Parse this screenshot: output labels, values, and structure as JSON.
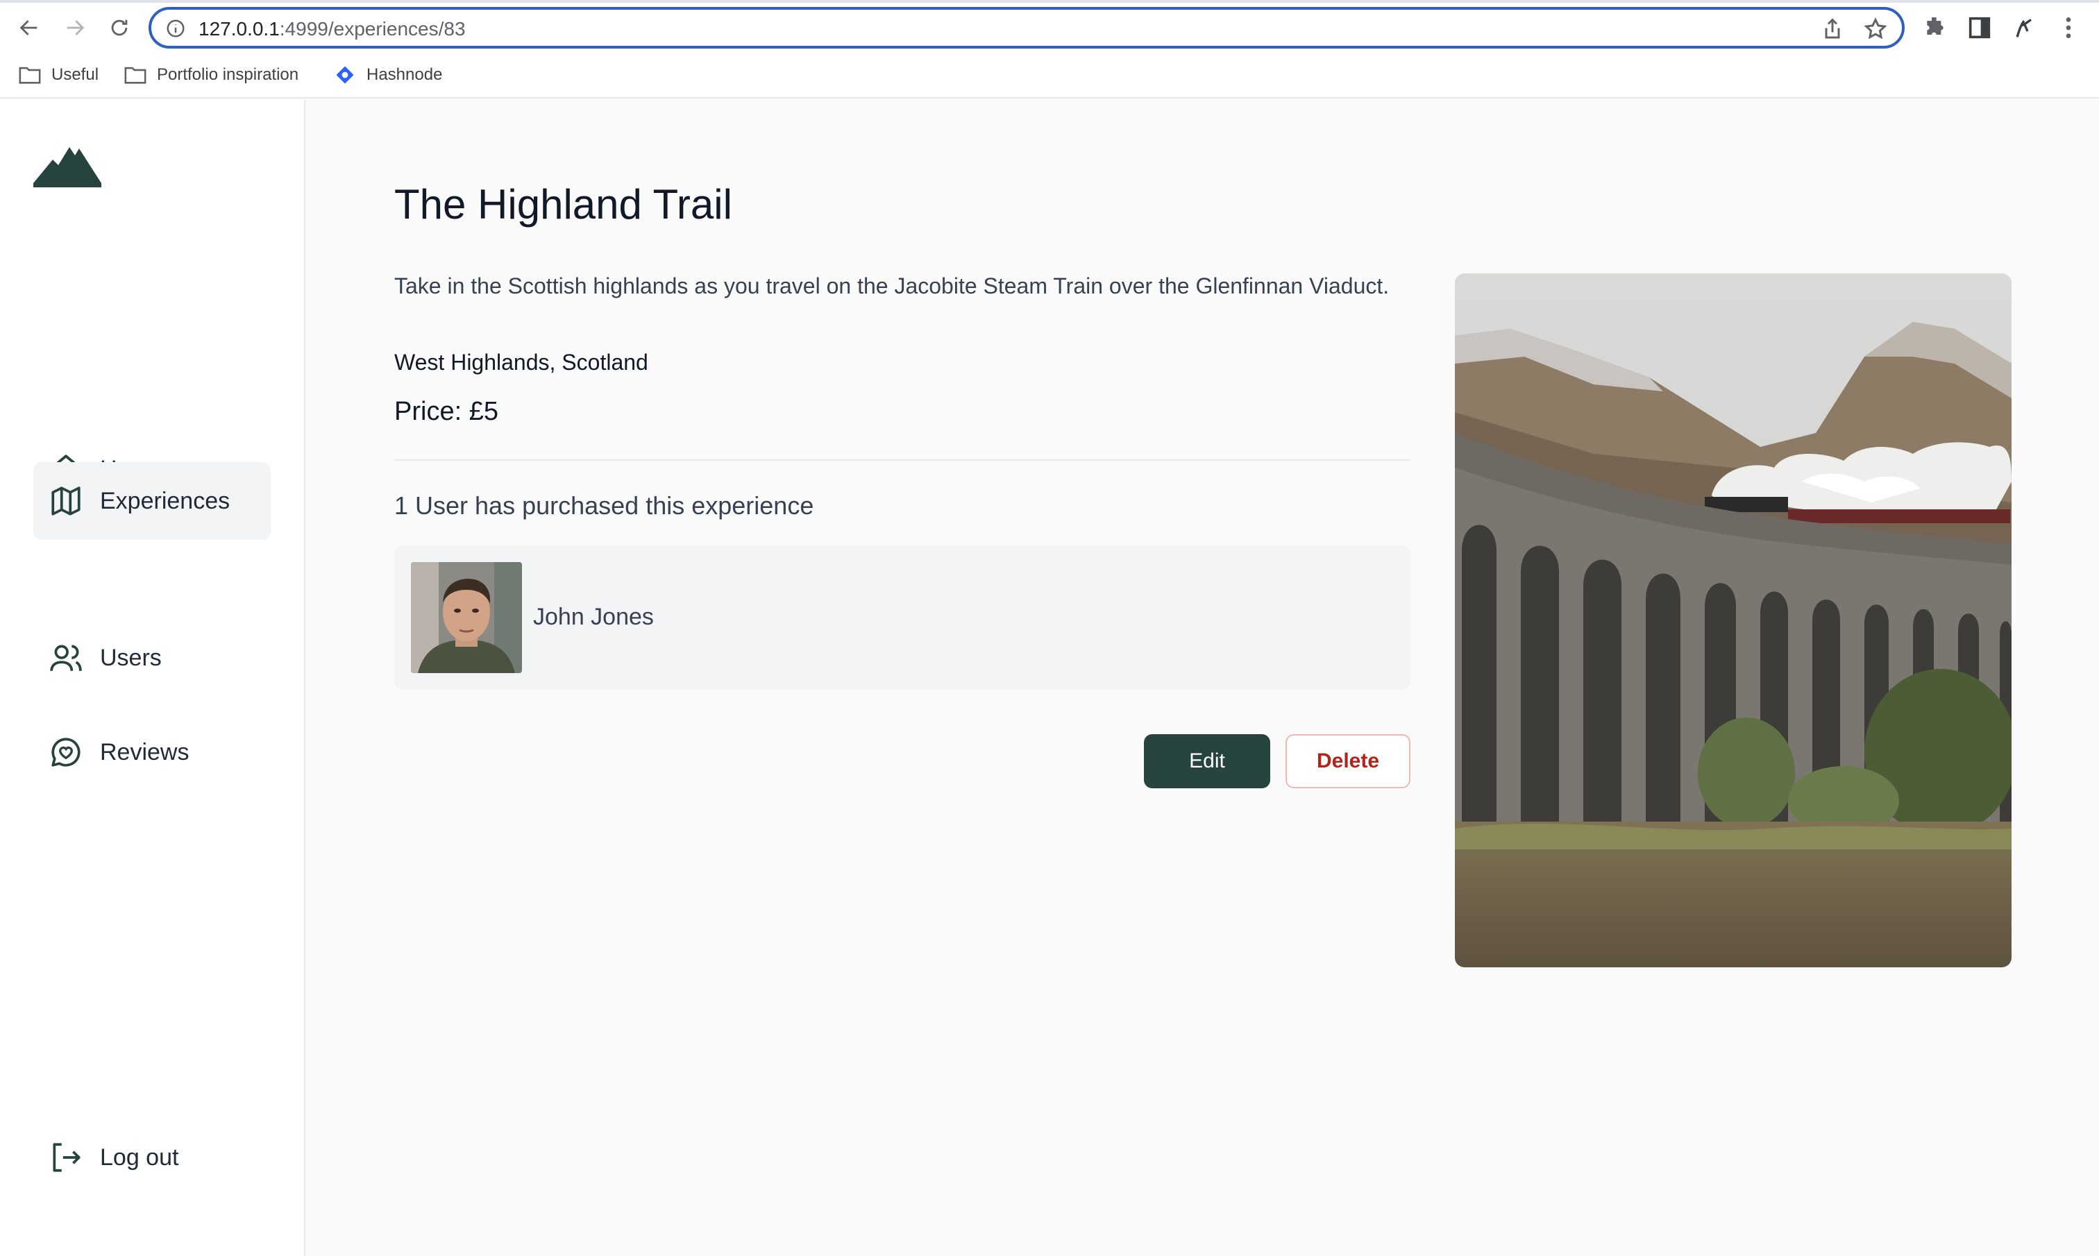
{
  "browser": {
    "url_host": "127.0.0.1",
    "url_path": ":4999/experiences/83",
    "bookmarks": [
      {
        "label": "Useful",
        "icon": "folder-icon"
      },
      {
        "label": "Portfolio inspiration",
        "icon": "folder-icon"
      },
      {
        "label": "Hashnode",
        "icon": "hashnode-icon"
      }
    ]
  },
  "sidebar": {
    "logo": "mountain-logo-icon",
    "items": [
      {
        "label": "Home",
        "icon": "home-icon",
        "active": false
      },
      {
        "label": "Experiences",
        "icon": "map-icon",
        "active": true
      },
      {
        "label": "Users",
        "icon": "users-icon",
        "active": false
      },
      {
        "label": "Reviews",
        "icon": "chat-heart-icon",
        "active": false
      }
    ],
    "logout": {
      "label": "Log out",
      "icon": "logout-icon"
    }
  },
  "experience": {
    "title": "The Highland Trail",
    "description": "Take in the Scottish highlands as you travel on the Jacobite Steam Train over the Glenfinnan Viaduct.",
    "location": "West Highlands, Scotland",
    "price": "Price: £5",
    "purchased_text": "1 User has purchased this experience",
    "buyers": [
      {
        "name": "John Jones"
      }
    ],
    "edit_label": "Edit",
    "delete_label": "Delete"
  },
  "colors": {
    "accent": "#27433d",
    "danger": "#b42318",
    "url_border": "#2f5fbf"
  }
}
